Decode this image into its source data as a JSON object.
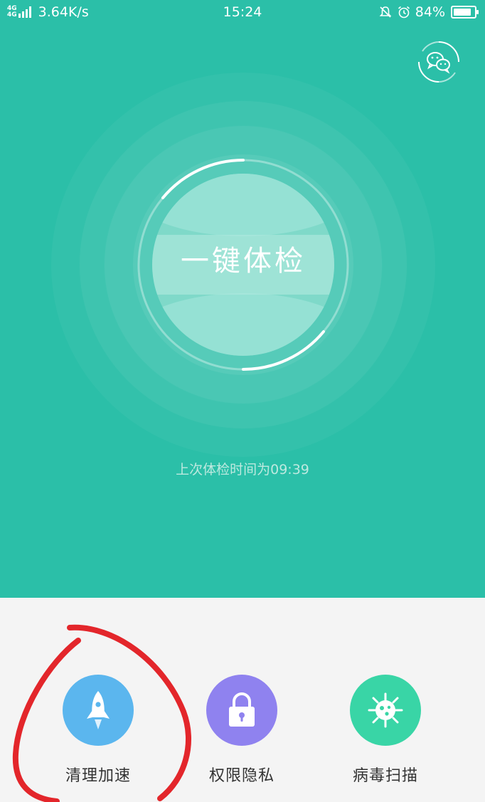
{
  "status_bar": {
    "network": "4G 4G",
    "speed": "3.64K/s",
    "time": "15:24",
    "battery": "84%",
    "battery_level": 0.84
  },
  "header": {
    "wechat_icon": "wechat-icon"
  },
  "scan": {
    "button_label": "一键体检",
    "last_check": "上次体检时间为09:39"
  },
  "features": [
    {
      "label": "清理加速",
      "icon": "rocket-icon",
      "color": "#5bb6ee"
    },
    {
      "label": "权限隐私",
      "icon": "lock-icon",
      "color": "#8f82ef"
    },
    {
      "label": "病毒扫描",
      "icon": "virus-icon",
      "color": "#39d5a6"
    }
  ],
  "colors": {
    "primary": "#2bbfa8",
    "background": "#f4f4f4",
    "annotation": "#e3262b"
  }
}
